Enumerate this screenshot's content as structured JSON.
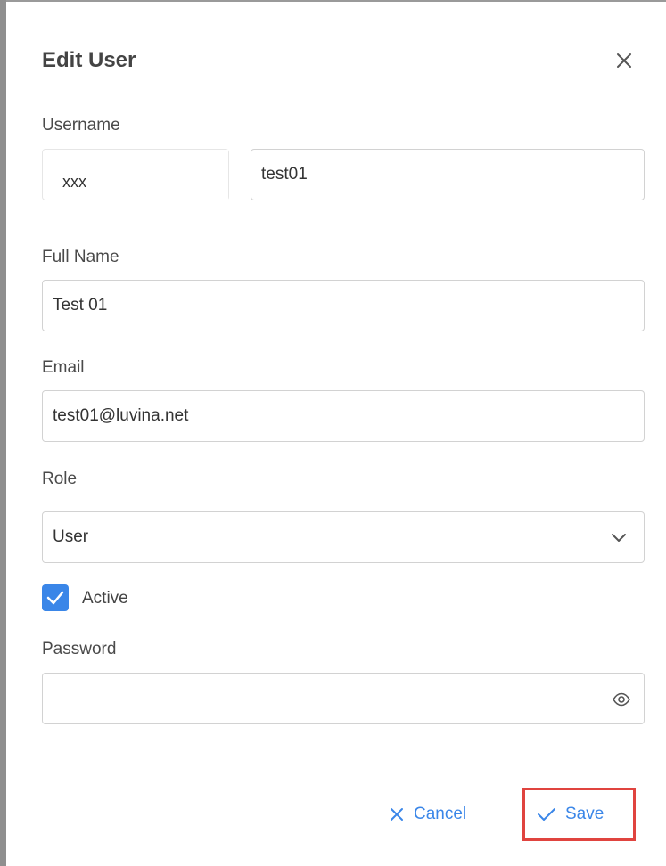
{
  "dialog": {
    "title": "Edit User"
  },
  "username": {
    "label": "Username",
    "prefix_value": "xxx",
    "value": "test01"
  },
  "full_name": {
    "label": "Full Name",
    "value": "Test 01"
  },
  "email": {
    "label": "Email",
    "value": "test01@luvina.net"
  },
  "role": {
    "label": "Role",
    "selected": "User"
  },
  "active": {
    "label": "Active",
    "checked": true
  },
  "password": {
    "label": "Password",
    "value": ""
  },
  "actions": {
    "cancel_label": "Cancel",
    "save_label": "Save"
  },
  "colors": {
    "accent": "#3a86e8",
    "highlight": "#e0443f"
  },
  "icons": {
    "close": "close-icon",
    "dropdown": "chevron-down-icon",
    "password_toggle": "eye-icon",
    "checkbox": "check-icon",
    "cancel": "x-icon",
    "save": "check-icon"
  }
}
